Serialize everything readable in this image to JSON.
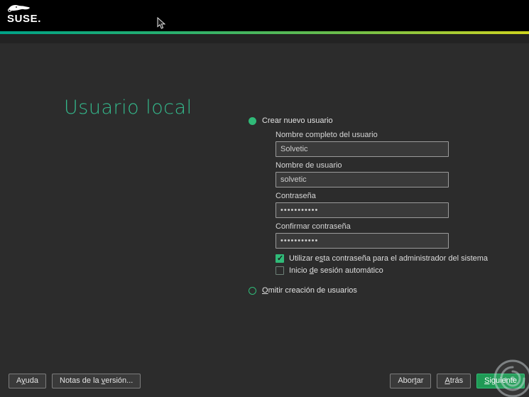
{
  "header": {
    "logo_text": "SUSE."
  },
  "page": {
    "title": "Usuario local"
  },
  "form": {
    "create_radio": {
      "label": "Crear nuevo usuario",
      "selected": true
    },
    "fields": {
      "fullname": {
        "label": "Nombre completo del usuario",
        "value": "Solvetic"
      },
      "username": {
        "label": "Nombre de usuario",
        "value": "solvetic"
      },
      "password": {
        "label": "Contraseña",
        "value": "•••••••••••"
      },
      "confirm": {
        "label": "Confirmar contraseña",
        "value": "•••••••••••"
      }
    },
    "checkboxes": {
      "admin_password": {
        "label_html": "Utilizar e<u>s</u>ta contraseña para el administrador del sistema",
        "checked": true
      },
      "autologin": {
        "label_html": "Inicio <u>d</u>e sesión automático",
        "checked": false
      }
    },
    "skip_radio": {
      "label_html": "<u>O</u>mitir creación de usuarios",
      "selected": false
    }
  },
  "footer": {
    "help_html": "A<u>y</u>uda",
    "release_notes_html": "Notas de la <u>v</u>ersión...",
    "abort_html": "Abor<u>t</u>ar",
    "back_html": "<u>A</u>trás",
    "next_html": "<u>S</u>iguiente"
  },
  "colors": {
    "accent_green": "#30ba78",
    "title_green": "#34b98c",
    "gradient_left": "#00a287",
    "gradient_right": "#cdd41e",
    "background": "#2c2c2c",
    "topbar": "#000000",
    "input_background": "#3a3a3a"
  }
}
